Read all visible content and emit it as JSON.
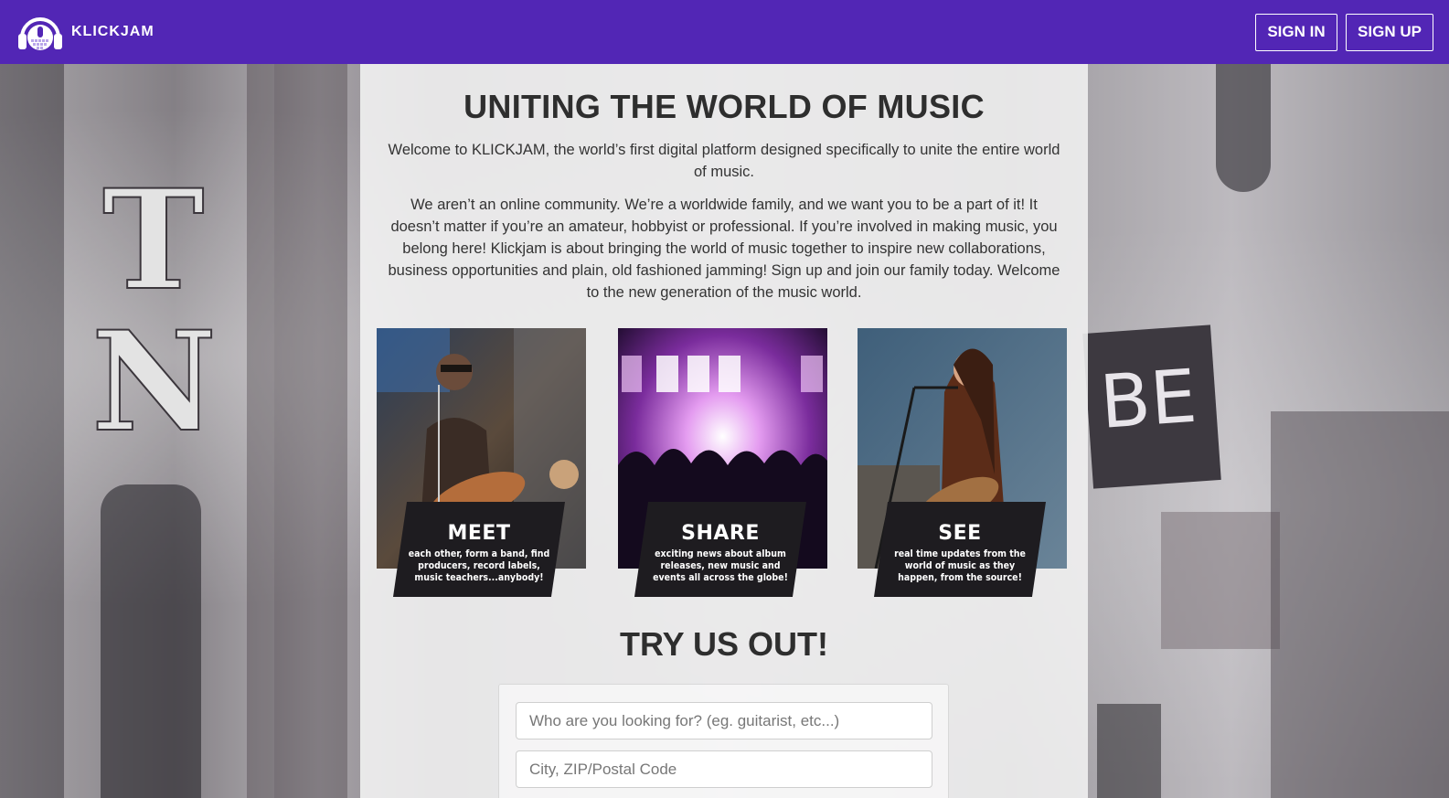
{
  "header": {
    "brand": "KLICKJAM",
    "sign_in": "SIGN IN",
    "sign_up": "SIGN UP",
    "bg_color": "#5226b5"
  },
  "main": {
    "headline": "UNITING THE WORLD OF MUSIC",
    "intro_1": "Welcome to KLICKJAM, the world’s first digital platform designed specifically to unite the entire world of music.",
    "intro_2": "We aren’t an online community. We’re a worldwide family, and we want you to be a part of it! It doesn’t matter if you’re an amateur, hobbyist or professional. If you’re involved in making music, you belong here! Klickjam is about bringing the world of music together to inspire new collaborations, business opportunities and plain, old fashioned jamming! Sign up and join our family today. Welcome to the new generation of the music world.",
    "cards": [
      {
        "title": "MEET",
        "text": "each other, form a band, find producers, record labels, music teachers...anybody!"
      },
      {
        "title": "SHARE",
        "text": "exciting news about album releases, new music and events all across the globe!"
      },
      {
        "title": "SEE",
        "text": "real time updates from the world of music as they happen, from the source!"
      }
    ],
    "try_title": "TRY US OUT!",
    "search": {
      "who_placeholder": "Who are you looking for? (eg. guitarist, etc...)",
      "where_placeholder": "City, ZIP/Postal Code"
    }
  },
  "background": {
    "letters": [
      "T",
      "N"
    ],
    "sign_text": "BE"
  }
}
